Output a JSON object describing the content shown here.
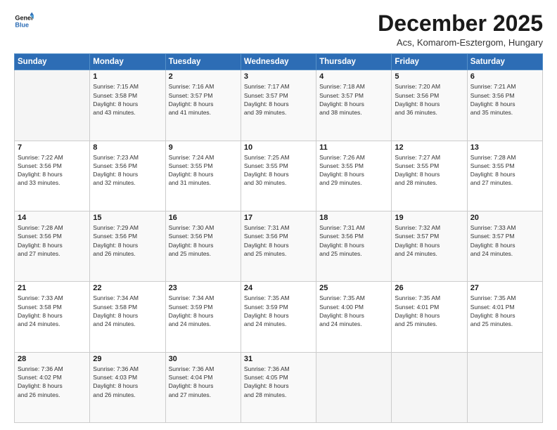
{
  "logo": {
    "line1": "General",
    "line2": "Blue"
  },
  "title": "December 2025",
  "subtitle": "Acs, Komarom-Esztergom, Hungary",
  "days_header": [
    "Sunday",
    "Monday",
    "Tuesday",
    "Wednesday",
    "Thursday",
    "Friday",
    "Saturday"
  ],
  "weeks": [
    [
      {
        "day": "",
        "info": ""
      },
      {
        "day": "1",
        "info": "Sunrise: 7:15 AM\nSunset: 3:58 PM\nDaylight: 8 hours\nand 43 minutes."
      },
      {
        "day": "2",
        "info": "Sunrise: 7:16 AM\nSunset: 3:57 PM\nDaylight: 8 hours\nand 41 minutes."
      },
      {
        "day": "3",
        "info": "Sunrise: 7:17 AM\nSunset: 3:57 PM\nDaylight: 8 hours\nand 39 minutes."
      },
      {
        "day": "4",
        "info": "Sunrise: 7:18 AM\nSunset: 3:57 PM\nDaylight: 8 hours\nand 38 minutes."
      },
      {
        "day": "5",
        "info": "Sunrise: 7:20 AM\nSunset: 3:56 PM\nDaylight: 8 hours\nand 36 minutes."
      },
      {
        "day": "6",
        "info": "Sunrise: 7:21 AM\nSunset: 3:56 PM\nDaylight: 8 hours\nand 35 minutes."
      }
    ],
    [
      {
        "day": "7",
        "info": "Sunrise: 7:22 AM\nSunset: 3:56 PM\nDaylight: 8 hours\nand 33 minutes."
      },
      {
        "day": "8",
        "info": "Sunrise: 7:23 AM\nSunset: 3:56 PM\nDaylight: 8 hours\nand 32 minutes."
      },
      {
        "day": "9",
        "info": "Sunrise: 7:24 AM\nSunset: 3:55 PM\nDaylight: 8 hours\nand 31 minutes."
      },
      {
        "day": "10",
        "info": "Sunrise: 7:25 AM\nSunset: 3:55 PM\nDaylight: 8 hours\nand 30 minutes."
      },
      {
        "day": "11",
        "info": "Sunrise: 7:26 AM\nSunset: 3:55 PM\nDaylight: 8 hours\nand 29 minutes."
      },
      {
        "day": "12",
        "info": "Sunrise: 7:27 AM\nSunset: 3:55 PM\nDaylight: 8 hours\nand 28 minutes."
      },
      {
        "day": "13",
        "info": "Sunrise: 7:28 AM\nSunset: 3:55 PM\nDaylight: 8 hours\nand 27 minutes."
      }
    ],
    [
      {
        "day": "14",
        "info": "Sunrise: 7:28 AM\nSunset: 3:56 PM\nDaylight: 8 hours\nand 27 minutes."
      },
      {
        "day": "15",
        "info": "Sunrise: 7:29 AM\nSunset: 3:56 PM\nDaylight: 8 hours\nand 26 minutes."
      },
      {
        "day": "16",
        "info": "Sunrise: 7:30 AM\nSunset: 3:56 PM\nDaylight: 8 hours\nand 25 minutes."
      },
      {
        "day": "17",
        "info": "Sunrise: 7:31 AM\nSunset: 3:56 PM\nDaylight: 8 hours\nand 25 minutes."
      },
      {
        "day": "18",
        "info": "Sunrise: 7:31 AM\nSunset: 3:56 PM\nDaylight: 8 hours\nand 25 minutes."
      },
      {
        "day": "19",
        "info": "Sunrise: 7:32 AM\nSunset: 3:57 PM\nDaylight: 8 hours\nand 24 minutes."
      },
      {
        "day": "20",
        "info": "Sunrise: 7:33 AM\nSunset: 3:57 PM\nDaylight: 8 hours\nand 24 minutes."
      }
    ],
    [
      {
        "day": "21",
        "info": "Sunrise: 7:33 AM\nSunset: 3:58 PM\nDaylight: 8 hours\nand 24 minutes."
      },
      {
        "day": "22",
        "info": "Sunrise: 7:34 AM\nSunset: 3:58 PM\nDaylight: 8 hours\nand 24 minutes."
      },
      {
        "day": "23",
        "info": "Sunrise: 7:34 AM\nSunset: 3:59 PM\nDaylight: 8 hours\nand 24 minutes."
      },
      {
        "day": "24",
        "info": "Sunrise: 7:35 AM\nSunset: 3:59 PM\nDaylight: 8 hours\nand 24 minutes."
      },
      {
        "day": "25",
        "info": "Sunrise: 7:35 AM\nSunset: 4:00 PM\nDaylight: 8 hours\nand 24 minutes."
      },
      {
        "day": "26",
        "info": "Sunrise: 7:35 AM\nSunset: 4:01 PM\nDaylight: 8 hours\nand 25 minutes."
      },
      {
        "day": "27",
        "info": "Sunrise: 7:35 AM\nSunset: 4:01 PM\nDaylight: 8 hours\nand 25 minutes."
      }
    ],
    [
      {
        "day": "28",
        "info": "Sunrise: 7:36 AM\nSunset: 4:02 PM\nDaylight: 8 hours\nand 26 minutes."
      },
      {
        "day": "29",
        "info": "Sunrise: 7:36 AM\nSunset: 4:03 PM\nDaylight: 8 hours\nand 26 minutes."
      },
      {
        "day": "30",
        "info": "Sunrise: 7:36 AM\nSunset: 4:04 PM\nDaylight: 8 hours\nand 27 minutes."
      },
      {
        "day": "31",
        "info": "Sunrise: 7:36 AM\nSunset: 4:05 PM\nDaylight: 8 hours\nand 28 minutes."
      },
      {
        "day": "",
        "info": ""
      },
      {
        "day": "",
        "info": ""
      },
      {
        "day": "",
        "info": ""
      }
    ]
  ]
}
